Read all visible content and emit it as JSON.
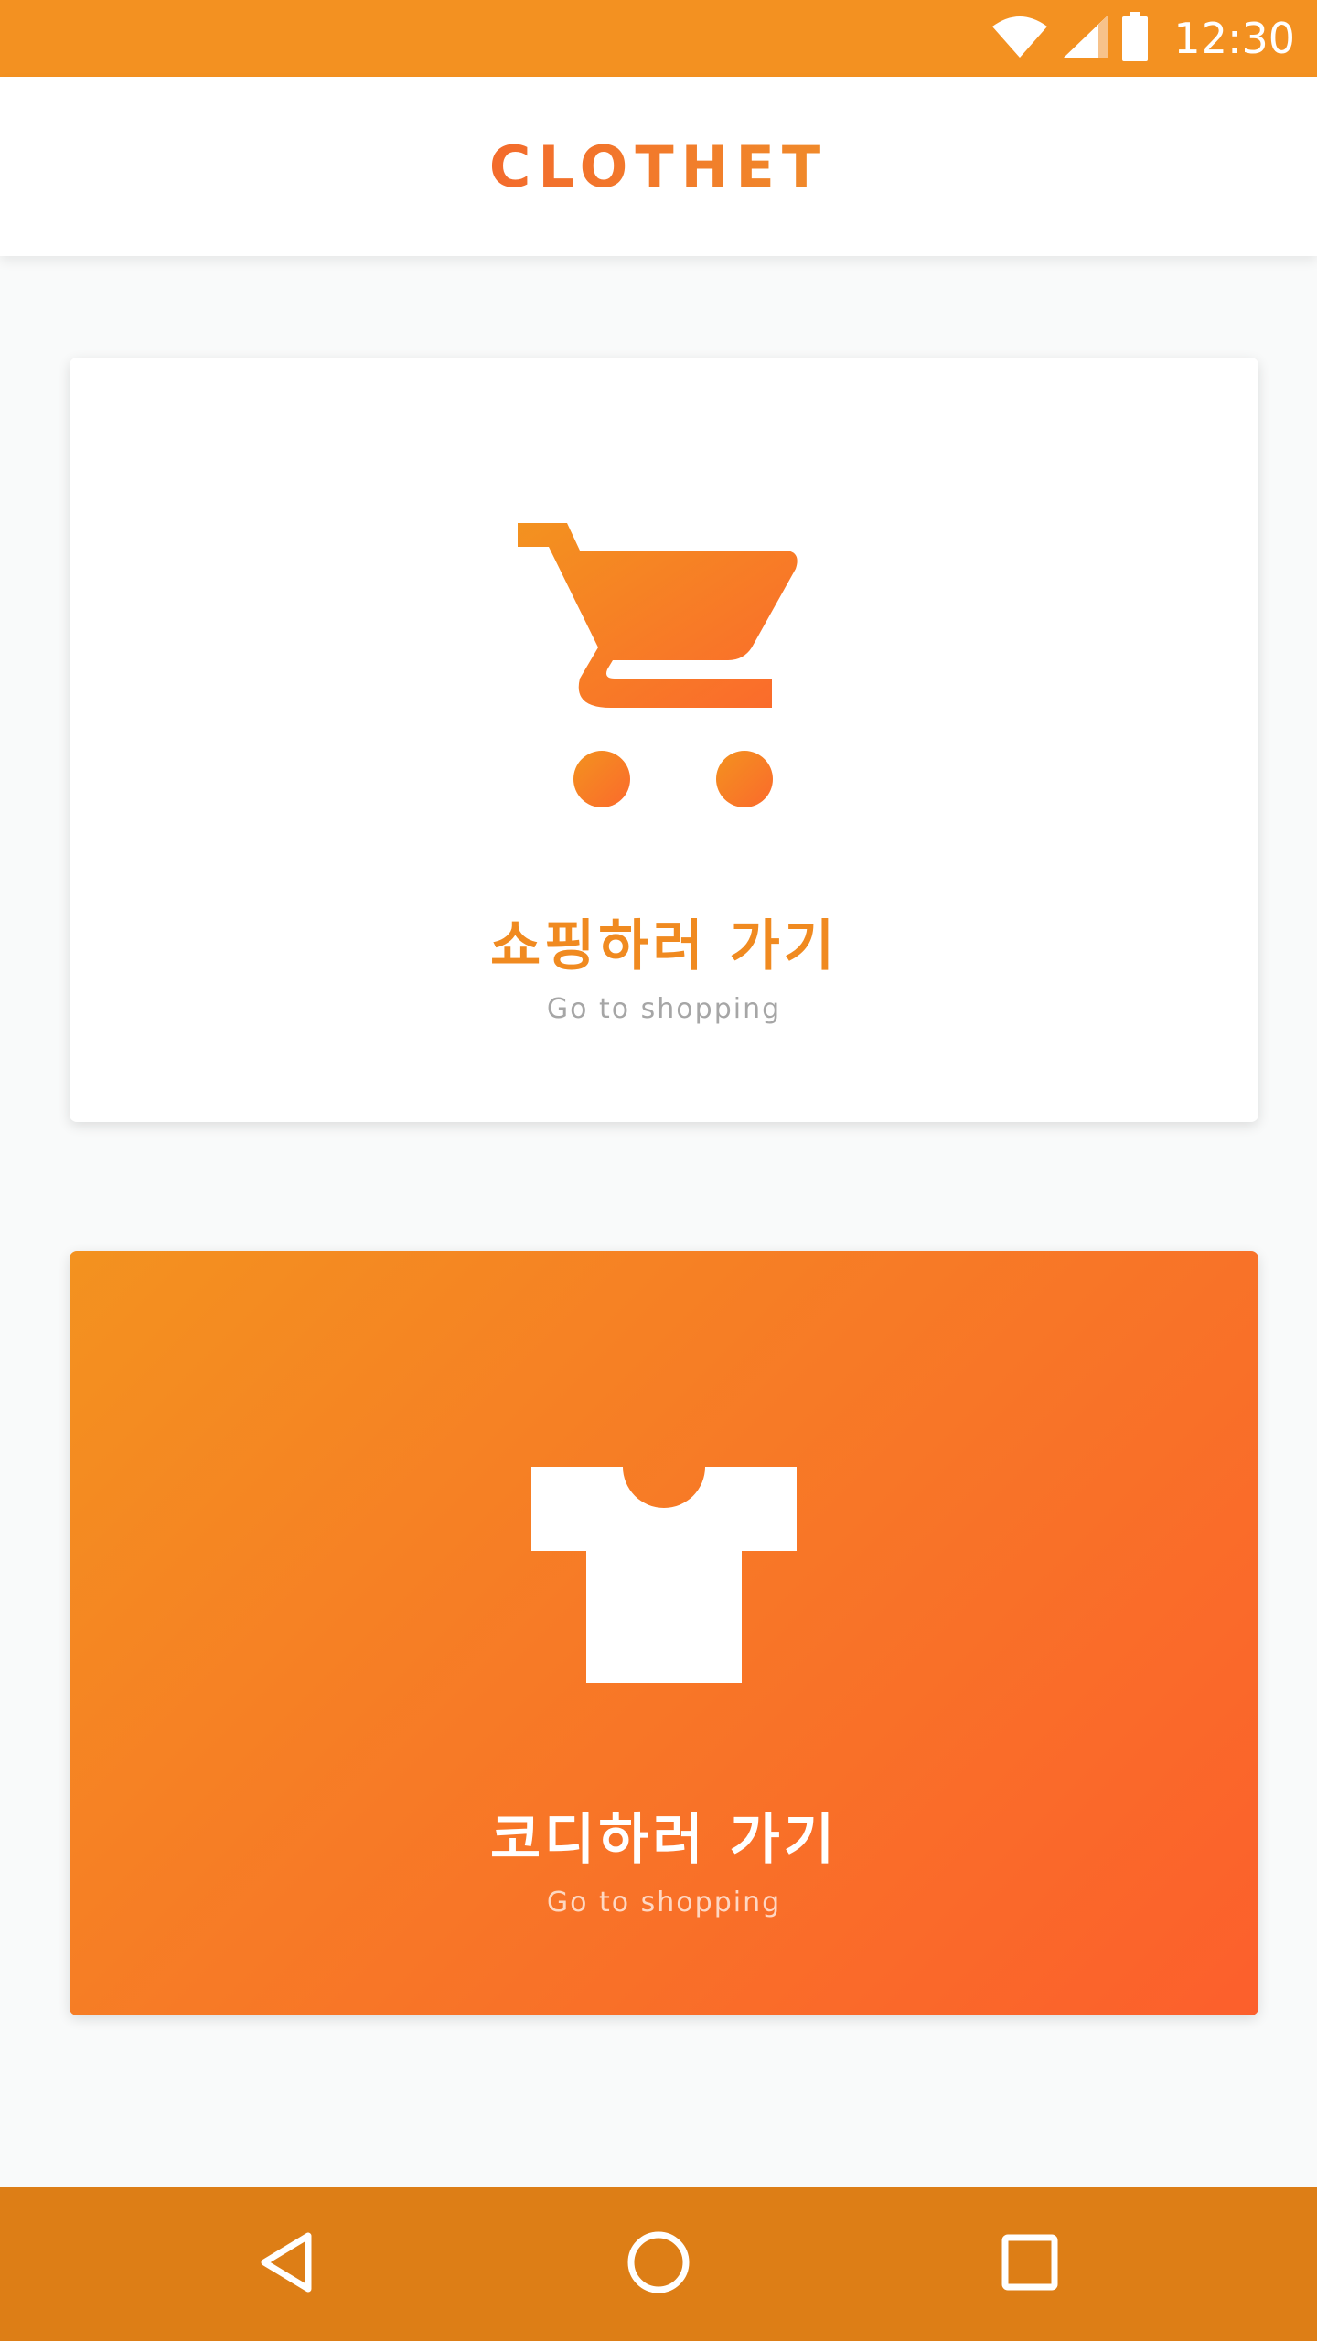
{
  "status_bar": {
    "time": "12:30",
    "icons": [
      "wifi-icon",
      "cellular-signal-icon",
      "battery-icon"
    ]
  },
  "app_bar": {
    "logo_text": "CLOTHET"
  },
  "cards": {
    "shop": {
      "icon": "shopping-cart-icon",
      "title": "쇼핑하러 가기",
      "subtitle": "Go to shopping"
    },
    "codi": {
      "icon": "t-shirt-icon",
      "title": "코디하러 가기",
      "subtitle": "Go to shopping"
    }
  },
  "nav_bar": {
    "buttons": [
      "back-icon",
      "home-icon",
      "recents-icon"
    ]
  },
  "colors": {
    "status_bar": "#f39121",
    "nav_bar": "#dd7e16",
    "accent_orange": "#f08a20",
    "gradient_start": "#f3921f",
    "gradient_end": "#fc5f2c",
    "background": "#f9fafa"
  }
}
